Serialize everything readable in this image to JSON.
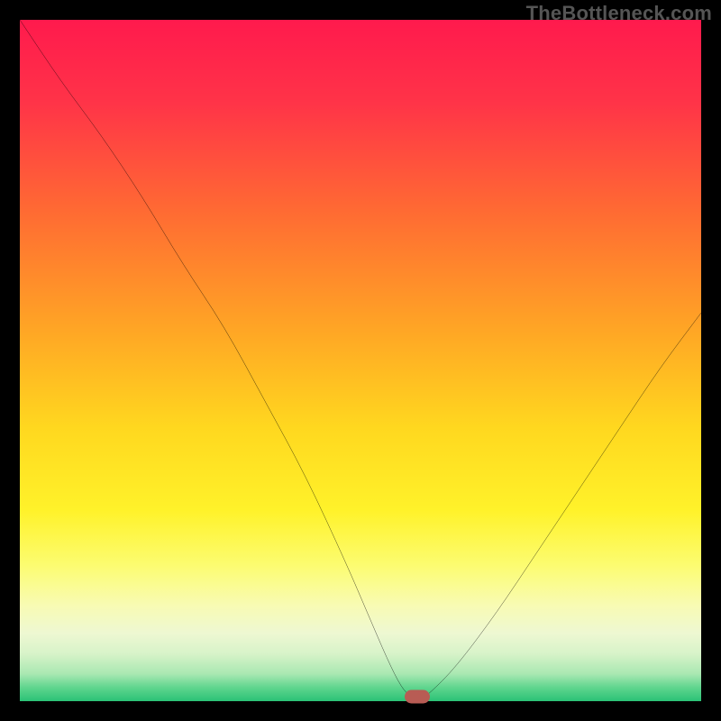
{
  "watermark": "TheBottleneck.com",
  "chart_data": {
    "type": "line",
    "title": "",
    "xlabel": "",
    "ylabel": "",
    "xlim": [
      0,
      100
    ],
    "ylim": [
      0,
      100
    ],
    "x": [
      0,
      6,
      12,
      18,
      24,
      30,
      36,
      42,
      48,
      51,
      54,
      56,
      57.5,
      59,
      60,
      64,
      70,
      76,
      82,
      88,
      94,
      100
    ],
    "values": [
      100,
      91,
      83,
      74,
      64,
      55,
      44,
      33,
      20,
      13,
      6,
      2,
      0.5,
      0.5,
      1,
      5,
      13,
      22,
      31,
      40,
      49,
      57
    ],
    "marker": {
      "x": 58.3,
      "y": 0.6,
      "color": "#b85c54"
    },
    "gradient_stops": [
      {
        "offset": 0,
        "color": "#ff1a4d"
      },
      {
        "offset": 12,
        "color": "#ff3348"
      },
      {
        "offset": 28,
        "color": "#ff6a33"
      },
      {
        "offset": 45,
        "color": "#ffa425"
      },
      {
        "offset": 60,
        "color": "#ffd81f"
      },
      {
        "offset": 72,
        "color": "#fff22a"
      },
      {
        "offset": 80,
        "color": "#fcfc70"
      },
      {
        "offset": 86,
        "color": "#f8fbb4"
      },
      {
        "offset": 90,
        "color": "#eef8d2"
      },
      {
        "offset": 93,
        "color": "#d8f3c9"
      },
      {
        "offset": 96,
        "color": "#a9e8b2"
      },
      {
        "offset": 98,
        "color": "#5fd58e"
      },
      {
        "offset": 100,
        "color": "#2bc276"
      }
    ]
  }
}
